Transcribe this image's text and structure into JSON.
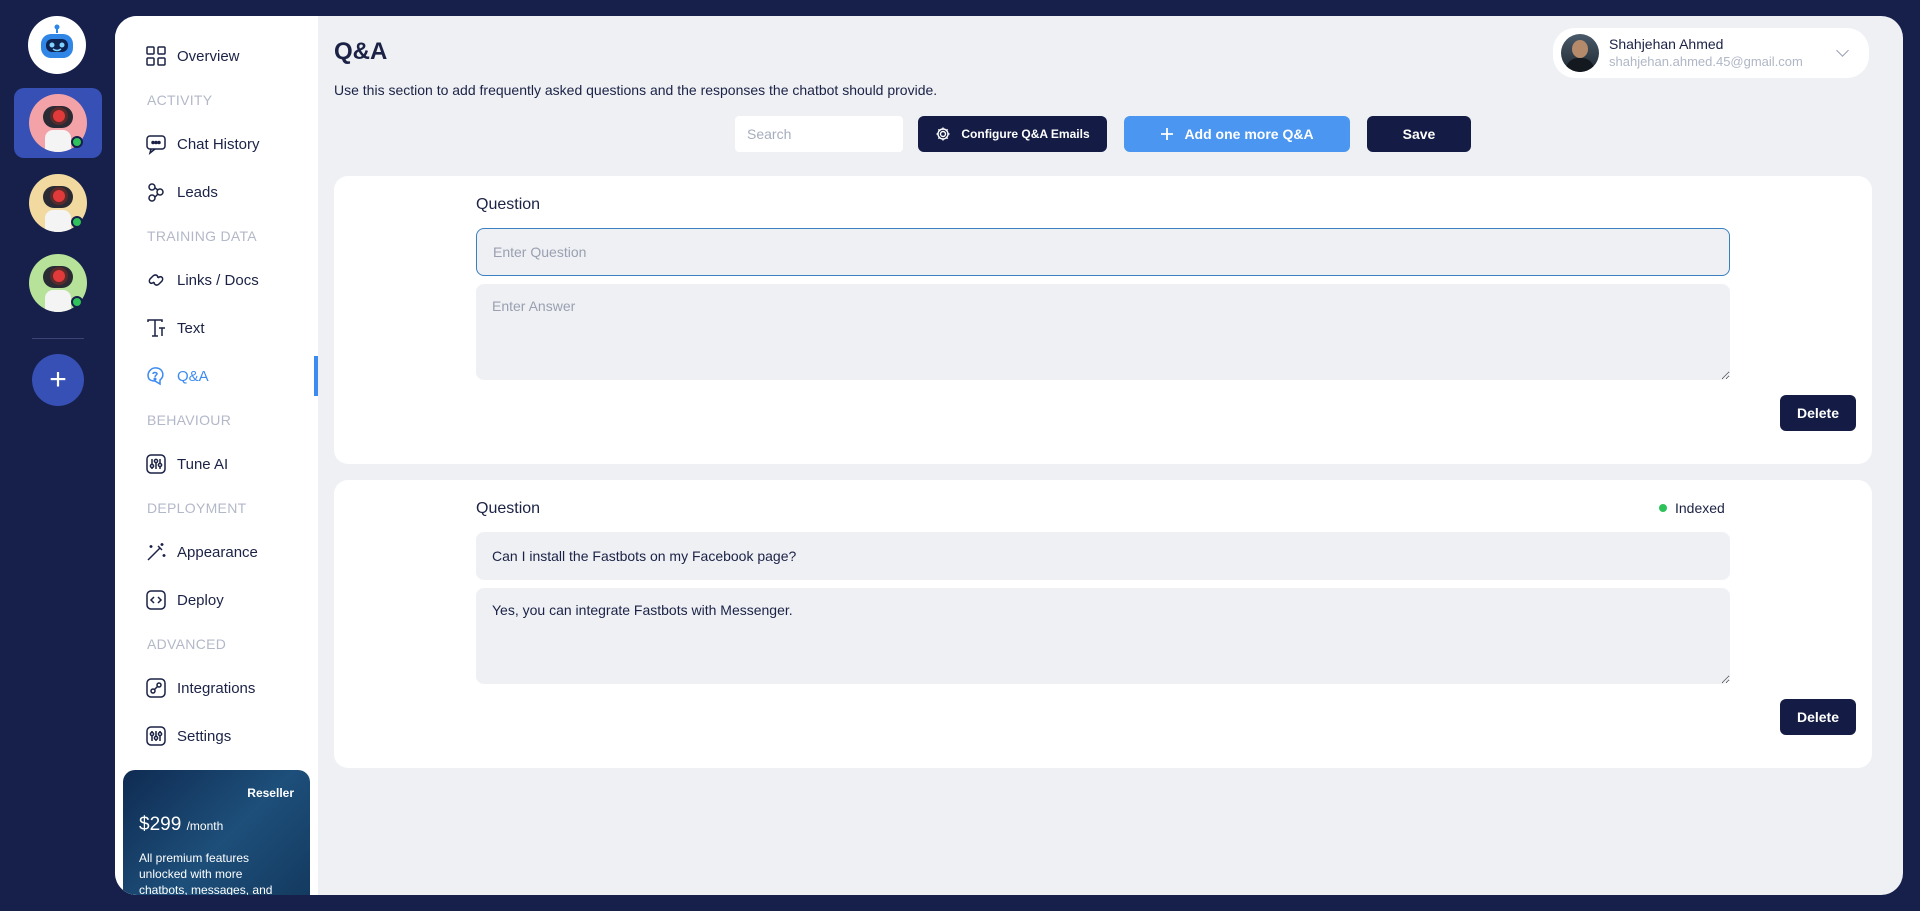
{
  "rail": {
    "bots": [
      {
        "name": "bot-1",
        "bg": "#f3a3a8",
        "online": true,
        "active": true
      },
      {
        "name": "bot-2",
        "bg": "#f1d9a0",
        "online": true,
        "active": false
      },
      {
        "name": "bot-3",
        "bg": "#b7e29a",
        "online": true,
        "active": false
      }
    ],
    "add_label": "+"
  },
  "sidebar": {
    "items": [
      {
        "label": "Overview",
        "icon": "grid-icon"
      },
      {
        "label": "Chat History",
        "icon": "chat-history-icon"
      },
      {
        "label": "Leads",
        "icon": "leads-icon"
      },
      {
        "label": "Links / Docs",
        "icon": "link-icon"
      },
      {
        "label": "Text",
        "icon": "text-icon"
      },
      {
        "label": "Q&A",
        "icon": "qa-icon"
      },
      {
        "label": "Tune AI",
        "icon": "tune-icon"
      },
      {
        "label": "Appearance",
        "icon": "wand-icon"
      },
      {
        "label": "Deploy",
        "icon": "code-icon"
      },
      {
        "label": "Integrations",
        "icon": "integrations-icon"
      },
      {
        "label": "Settings",
        "icon": "settings-icon"
      }
    ],
    "sections": [
      "ACTIVITY",
      "TRAINING DATA",
      "BEHAVIOUR",
      "DEPLOYMENT",
      "ADVANCED"
    ],
    "promo": {
      "tier": "Reseller",
      "price": "$299",
      "period": "/month",
      "description": "All premium features unlocked with more chatbots, messages, and"
    }
  },
  "header": {
    "title": "Q&A",
    "description": "Use this section to add frequently asked questions and the responses the chatbot should provide."
  },
  "user": {
    "name": "Shahjehan Ahmed",
    "email": "shahjehan.ahmed.45@gmail.com"
  },
  "toolbar": {
    "search_placeholder": "Search",
    "configure_label": "Configure Q&A Emails",
    "add_label": "Add one more Q&A",
    "save_label": "Save"
  },
  "qa": {
    "question_label": "Question",
    "question_placeholder": "Enter Question",
    "answer_placeholder": "Enter Answer",
    "delete_label": "Delete",
    "entries": [
      {
        "question": "",
        "answer": "",
        "status": ""
      },
      {
        "question": "Can I install the Fastbots on my Facebook page?",
        "answer": "Yes, you can integrate Fastbots with Messenger.",
        "status": "Indexed"
      }
    ]
  },
  "colors": {
    "navy": "#16204a",
    "accent": "#3d8bf0",
    "button_dark": "#141c46",
    "button_blue": "#4a96f0",
    "online": "#2fc25b"
  }
}
